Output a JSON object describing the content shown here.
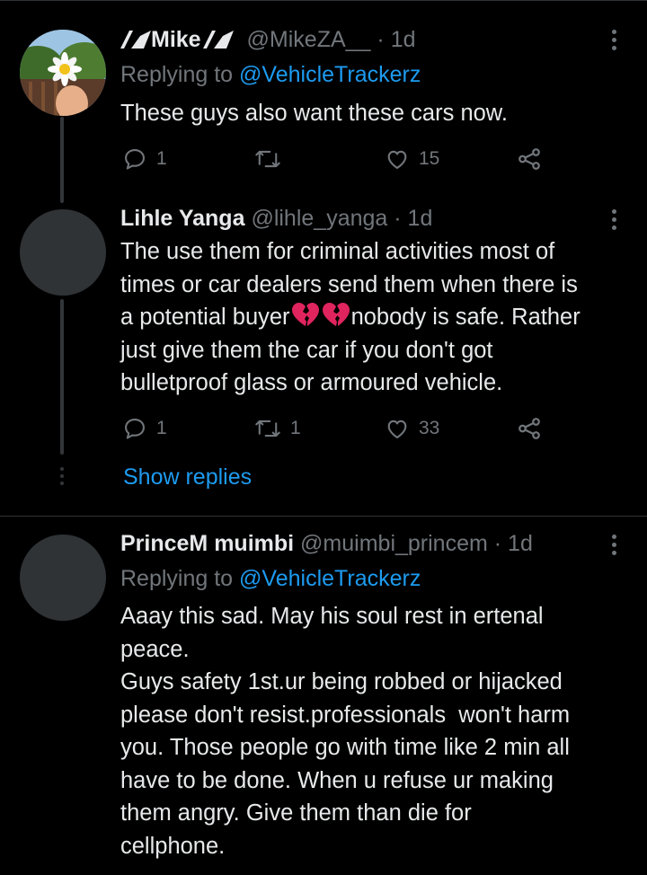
{
  "tweets": [
    {
      "display_name": "Mike",
      "handle": "@MikeZA__",
      "time": "1d",
      "replying_prefix": "Replying to",
      "replying_to": "@VehicleTrackerz",
      "text": "These guys also want these cars now.",
      "reply_count": "1",
      "retweet_count": "",
      "like_count": "15"
    },
    {
      "display_name": "Lihle Yanga",
      "handle": "@lihle_yanga",
      "time": "1d",
      "text_lines": [
        "The use them for criminal activities most of",
        "times or car dealers send them when there is",
        "a potential buyer",
        "nobody is safe. Rather",
        "just give them the car if you don't got",
        "bulletproof glass or armoured vehicle."
      ],
      "reply_count": "1",
      "retweet_count": "1",
      "like_count": "33"
    },
    {
      "display_name": "PrinceM muimbi",
      "handle": "@muimbi_princem",
      "time": "1d",
      "replying_prefix": "Replying to",
      "replying_to": "@VehicleTrackerz",
      "text_lines": [
        "Aaay this sad. May his soul rest in ertenal",
        "peace.",
        "Guys safety 1st.ur being robbed or hijacked",
        "please don't resist.professionals  won't harm",
        "you. Those people go with time like 2 min all",
        "have to be done. When u refuse ur making",
        "them angry. Give them than die for",
        "cellphone."
      ]
    }
  ],
  "show_replies": "Show replies",
  "separator": "·",
  "colors": {
    "background": "#000000",
    "text": "#e7e9ea",
    "secondary": "#71767b",
    "link": "#1d9bf0",
    "divider": "#2f3336"
  },
  "icons": [
    "reply-icon",
    "retweet-icon",
    "like-icon",
    "share-icon",
    "more-icon",
    "broken-heart-emoji",
    "flag-badge-icon"
  ]
}
